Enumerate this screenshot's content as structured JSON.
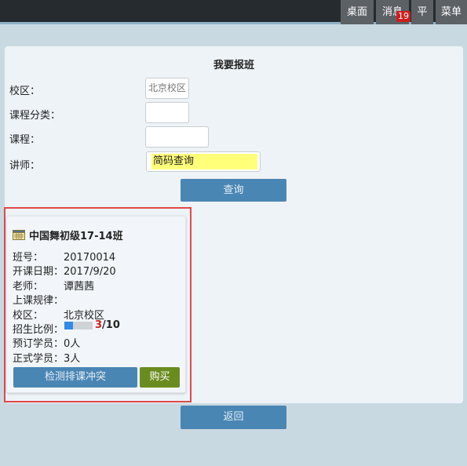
{
  "topnav": {
    "items": [
      {
        "label": "桌面"
      },
      {
        "label": "消息",
        "badge": "19"
      },
      {
        "label": "平"
      },
      {
        "label": "菜单"
      }
    ]
  },
  "form": {
    "title": "我要报班",
    "campus_label": "校区：",
    "campus_value": "北京校区",
    "category_label": "课程分类：",
    "category_value": "",
    "course_label": "课程：",
    "course_value": "",
    "teacher_label": "讲师：",
    "teacher_placeholder": "简码查询",
    "query_button": "查询"
  },
  "class_card": {
    "title": "中国舞初级17-14班",
    "icon": "calendar-icon",
    "class_no_label": "班号：",
    "class_no": "20170014",
    "start_date_label": "开课日期：",
    "start_date": "2017/9/20",
    "teacher_label": "老师：",
    "teacher": "谭茜茜",
    "schedule_label": "上课规律：",
    "schedule": "",
    "campus_label": "校区：",
    "campus": "北京校区",
    "enroll_label": "招生比例：",
    "enroll_current": "3",
    "enroll_sep_total": "/10",
    "enroll_fraction": 0.3,
    "reserved_label": "预订学员：",
    "reserved": "0人",
    "formal_label": "正式学员：",
    "formal": "3人",
    "check_button": "检测排课冲突",
    "buy_button": "购买"
  },
  "back_button": "返回",
  "colors": {
    "accent_blue": "#4a86b4",
    "buy_green": "#6a8c1e",
    "highlight_red": "#e04848",
    "badge_red": "#d11d1d",
    "teacher_field_yellow": "#ffff7a"
  }
}
